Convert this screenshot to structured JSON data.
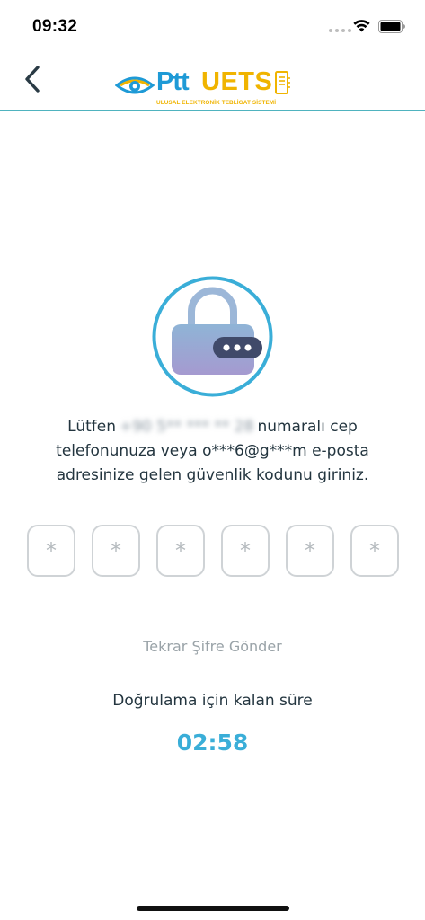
{
  "status_bar": {
    "time": "09:32",
    "icons": [
      "signal-dots",
      "wifi-icon",
      "battery-icon"
    ]
  },
  "header": {
    "back_icon": "chevron-left-icon",
    "logo": {
      "ptt": "Ptt",
      "uets": "UETS",
      "subtitle": "ULUSAL ELEKTRONİK TEBLİGAT SİSTEMİ"
    }
  },
  "illustration": {
    "icon": "lock-icon"
  },
  "message": {
    "prefix": "Lütfen",
    "phone_masked": "+90 5** *** ** 28",
    "suffix": "numaralı cep telefonunuza veya o***6@g***m e-posta adresinize gelen güvenlik kodunu giriniz."
  },
  "code_inputs": {
    "placeholder": "*",
    "count": 6
  },
  "resend_label": "Tekrar Şifre Gönder",
  "remaining_label": "Doğrulama için kalan süre",
  "timer": "02:58",
  "colors": {
    "accent": "#3aaed8",
    "brand_blue": "#1e9ad6",
    "brand_yellow": "#f0b400",
    "divider": "#4fb3bf"
  }
}
